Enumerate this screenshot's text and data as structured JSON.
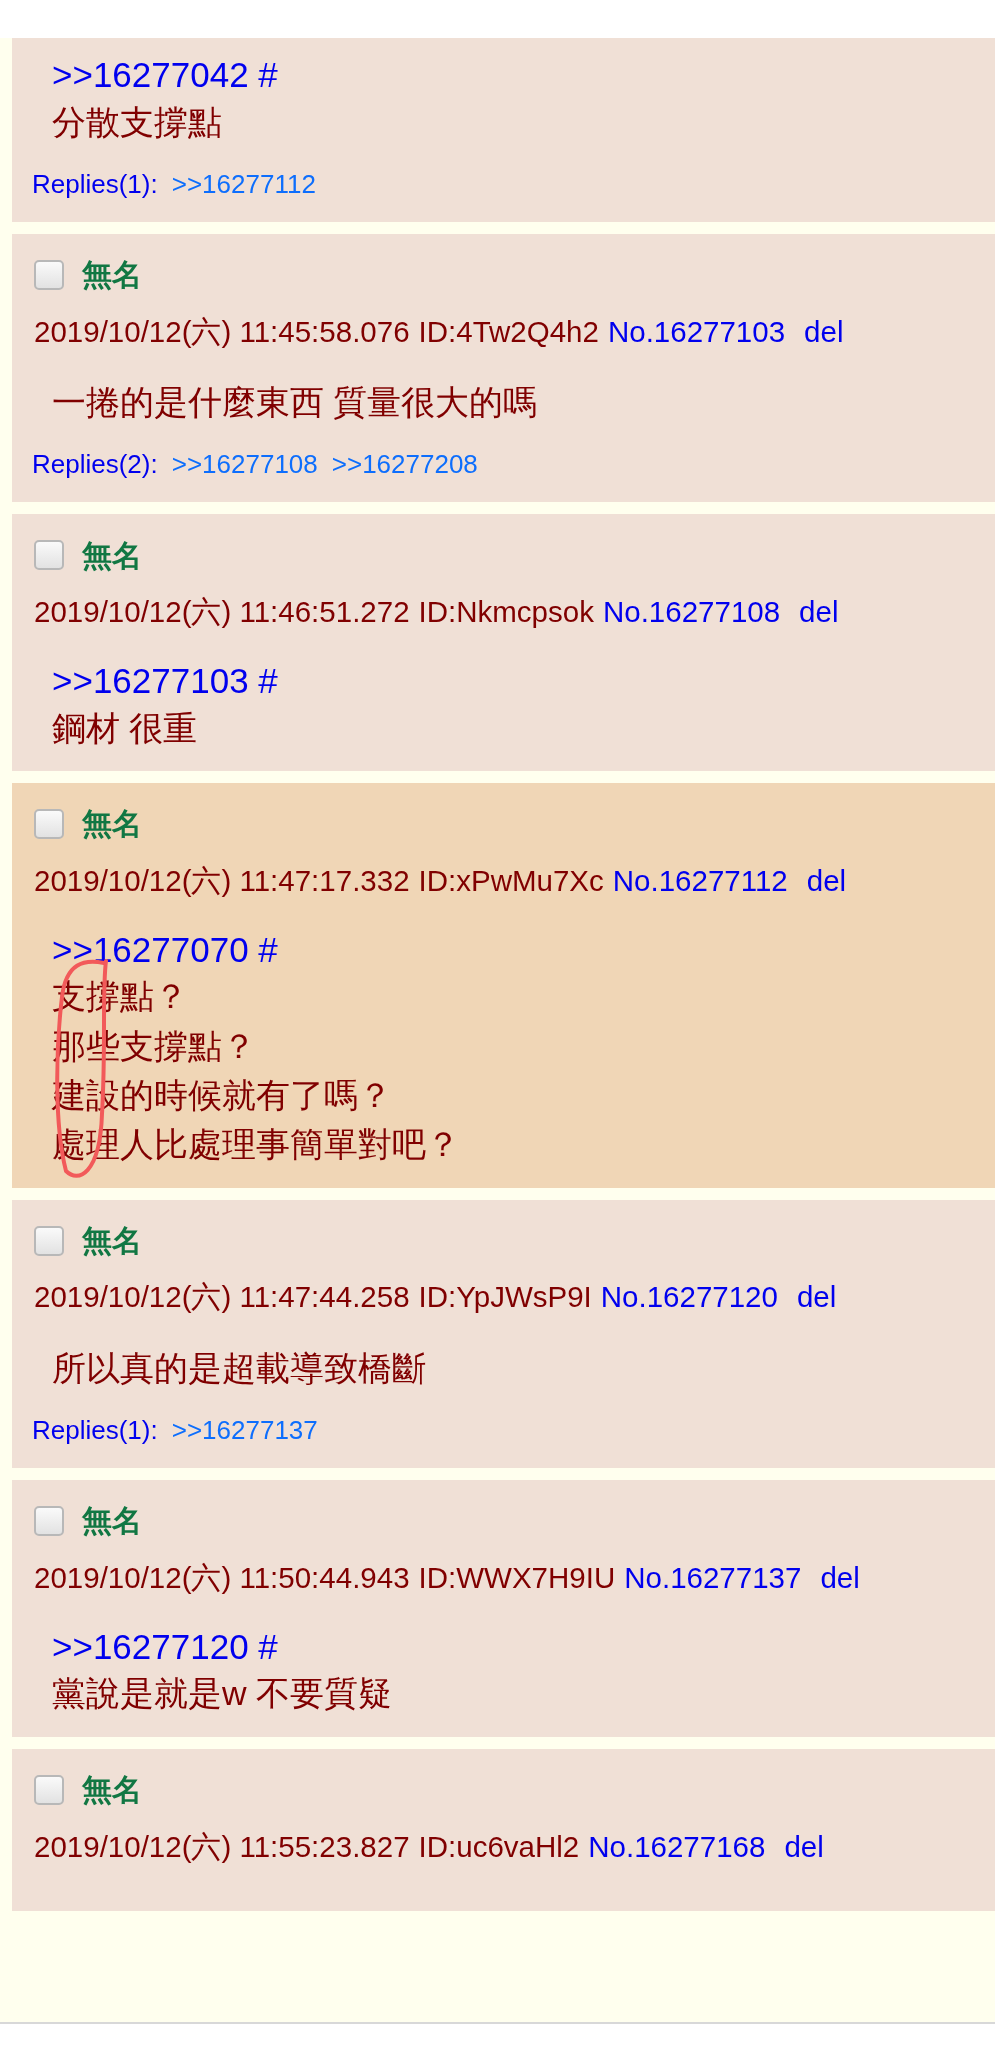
{
  "posts": [
    {
      "quote": ">>16277042 #",
      "body": [
        "分散支撐點"
      ],
      "replies_label": "Replies(1):",
      "replies": [
        ">>16277112"
      ]
    },
    {
      "checked": false,
      "name": "無名",
      "datetime": "2019/10/12(六) 11:45:58.076",
      "uid": "ID:4Tw2Q4h2",
      "number": "No.16277103",
      "del": "del",
      "body": [
        "一捲的是什麼東西 質量很大的嗎"
      ],
      "replies_label": "Replies(2):",
      "replies": [
        ">>16277108",
        ">>16277208"
      ]
    },
    {
      "checked": false,
      "name": "無名",
      "datetime": "2019/10/12(六) 11:46:51.272",
      "uid": "ID:Nkmcpsok",
      "number": "No.16277108",
      "del": "del",
      "quote": ">>16277103 #",
      "body": [
        "鋼材 很重"
      ]
    },
    {
      "checked": false,
      "highlighted": true,
      "annotated": true,
      "name": "無名",
      "datetime": "2019/10/12(六) 11:47:17.332",
      "uid": "ID:xPwMu7Xc",
      "number": "No.16277112",
      "del": "del",
      "quote": ">>16277070 #",
      "body": [
        "支撐點？",
        "那些支撐點？",
        "建設的時候就有了嗎？",
        "處理人比處理事簡單對吧？"
      ]
    },
    {
      "checked": false,
      "name": "無名",
      "datetime": "2019/10/12(六) 11:47:44.258",
      "uid": "ID:YpJWsP9I",
      "number": "No.16277120",
      "del": "del",
      "body": [
        "所以真的是超載導致橋斷"
      ],
      "replies_label": "Replies(1):",
      "replies": [
        ">>16277137"
      ]
    },
    {
      "checked": false,
      "name": "無名",
      "datetime": "2019/10/12(六) 11:50:44.943",
      "uid": "ID:WWX7H9IU",
      "number": "No.16277137",
      "del": "del",
      "quote": ">>16277120 #",
      "body": [
        "黨說是就是w 不要質疑"
      ]
    },
    {
      "checked": false,
      "name": "無名",
      "datetime": "2019/10/12(六) 11:55:23.827",
      "uid": "ID:uc6vaHl2",
      "number": "No.16277168",
      "del": "del"
    }
  ]
}
